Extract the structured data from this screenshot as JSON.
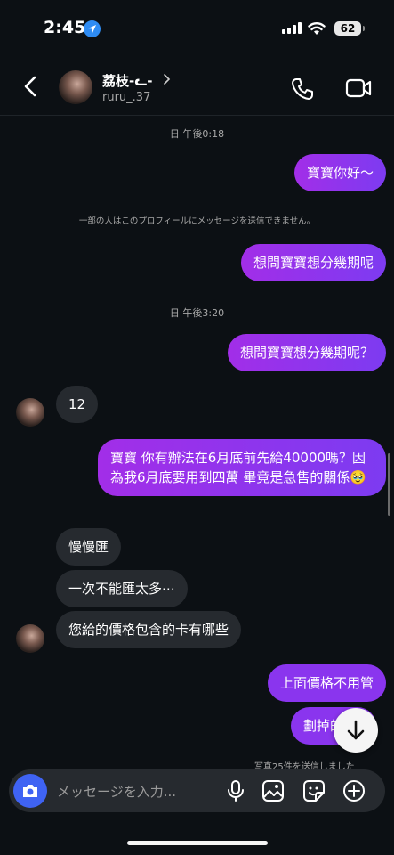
{
  "status": {
    "time": "2:45",
    "battery": "62"
  },
  "header": {
    "name": "荔枝-ᓚ-",
    "username": "ruru_.37"
  },
  "messages": {
    "ts1": "日 午後0:18",
    "m1": "寶寶你好〜",
    "notice": "一部の人はこのプロフィールにメッセージを送信できません。",
    "m2": "想問寶寶想分幾期呢",
    "ts2": "日 午後3:20",
    "m3": "想問寶寶想分幾期呢？",
    "r1": "12",
    "m4": "寶寶 你有辦法在6月底前先給40000嗎？因為我6月底要用到四萬 畢竟是急售的關係🥹",
    "r2": "慢慢匯",
    "r3": "一次不能匯太多⋯",
    "r4": "您給的價格包含的卡有哪些",
    "m5": "上面價格不用管",
    "m6": "劃掉的"
  },
  "sent_note": "写真25件を送信しました",
  "input": {
    "placeholder": "メッセージを入力..."
  },
  "icons": {
    "back": "chevron-left-icon",
    "call": "phone-icon",
    "video": "video-camera-icon",
    "camera": "camera-icon",
    "mic": "microphone-icon",
    "gallery": "image-icon",
    "sticker": "sticker-icon",
    "plus": "plus-circle-icon",
    "scroll_down": "arrow-down-icon"
  },
  "colors": {
    "sent_bubble": "#8a35ee",
    "received_bubble": "#262a2f",
    "camera_button": "#3f63f3",
    "background": "#0c1014"
  }
}
